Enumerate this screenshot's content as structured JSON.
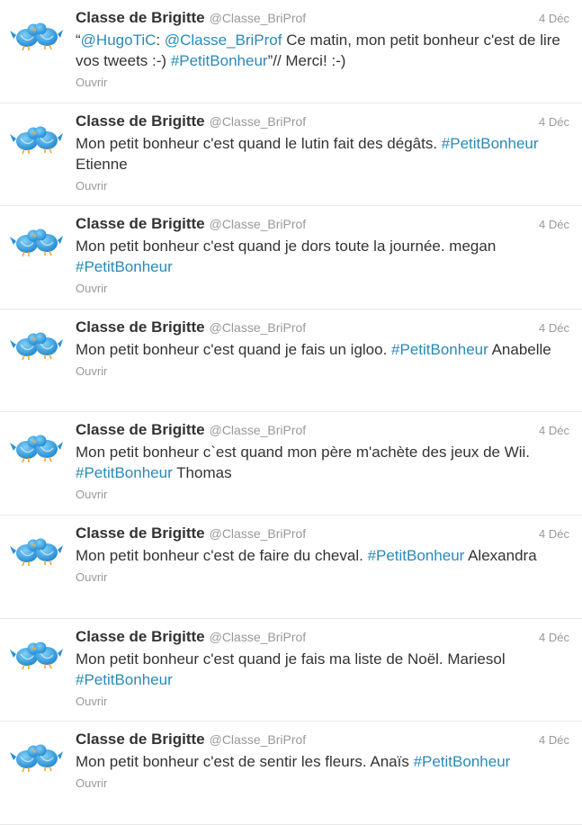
{
  "timeline": {
    "tweets": [
      {
        "name": "Classe de Brigitte",
        "handle": "@Classe_BriProf",
        "date": "4 Déc",
        "segments": [
          {
            "t": "“"
          },
          {
            "t": "@HugoTiC",
            "link": true
          },
          {
            "t": ": "
          },
          {
            "t": "@Classe_BriProf",
            "link": true
          },
          {
            "t": " Ce matin, mon petit bonheur c'est de lire vos tweets :-) "
          },
          {
            "t": "#PetitBonheur",
            "link": true
          },
          {
            "t": "”// Merci! :-)"
          }
        ],
        "open_label": "Ouvrir"
      },
      {
        "name": "Classe de Brigitte",
        "handle": "@Classe_BriProf",
        "date": "4 Déc",
        "segments": [
          {
            "t": "Mon petit bonheur c'est quand le lutin fait des dégâts. "
          },
          {
            "t": "#PetitBonheur",
            "link": true
          },
          {
            "t": " Etienne"
          }
        ],
        "open_label": "Ouvrir"
      },
      {
        "name": "Classe de Brigitte",
        "handle": "@Classe_BriProf",
        "date": "4 Déc",
        "segments": [
          {
            "t": "Mon petit bonheur c'est quand je dors toute la journée. megan "
          },
          {
            "t": "#PetitBonheur",
            "link": true
          }
        ],
        "open_label": "Ouvrir"
      },
      {
        "name": "Classe de Brigitte",
        "handle": "@Classe_BriProf",
        "date": "4 Déc",
        "segments": [
          {
            "t": "Mon petit bonheur c'est quand je fais un igloo. "
          },
          {
            "t": "#PetitBonheur",
            "link": true
          },
          {
            "t": " Anabelle"
          }
        ],
        "open_label": "Ouvrir"
      },
      {
        "name": "Classe de Brigitte",
        "handle": "@Classe_BriProf",
        "date": "4 Déc",
        "segments": [
          {
            "t": "Mon petit bonheur c`est quand mon père m'achète des jeux de Wii. "
          },
          {
            "t": "#PetitBonheur",
            "link": true
          },
          {
            "t": " Thomas"
          }
        ],
        "open_label": "Ouvrir"
      },
      {
        "name": "Classe de Brigitte",
        "handle": "@Classe_BriProf",
        "date": "4 Déc",
        "segments": [
          {
            "t": "Mon petit bonheur c'est de faire du cheval. "
          },
          {
            "t": "#PetitBonheur",
            "link": true
          },
          {
            "t": " Alexandra"
          }
        ],
        "open_label": "Ouvrir"
      },
      {
        "name": "Classe de Brigitte",
        "handle": "@Classe_BriProf",
        "date": "4 Déc",
        "segments": [
          {
            "t": "Mon petit bonheur c'est quand je fais ma liste de Noël. Mariesol "
          },
          {
            "t": "#PetitBonheur",
            "link": true
          }
        ],
        "open_label": "Ouvrir"
      },
      {
        "name": "Classe de Brigitte",
        "handle": "@Classe_BriProf",
        "date": "4 Déc",
        "segments": [
          {
            "t": "Mon petit bonheur c'est de sentir les fleurs. Anaïs "
          },
          {
            "t": "#PetitBonheur",
            "link": true
          }
        ],
        "open_label": "Ouvrir"
      }
    ]
  },
  "avatar_icon": "two-blue-birds-icon",
  "colors": {
    "link": "#2a8ab8",
    "text": "#333333",
    "muted": "#999999",
    "divider": "#e8e8e8",
    "bird": "#3a9ee0"
  }
}
